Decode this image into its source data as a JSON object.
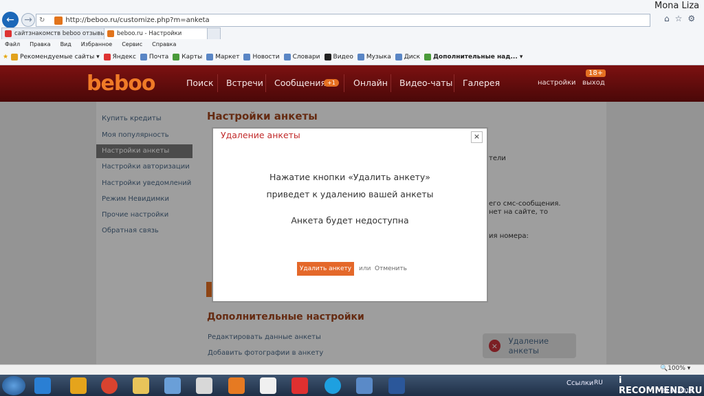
{
  "browser": {
    "url": "http://beboo.ru/customize.php?m=anketa",
    "title_user": "Mona Liza",
    "tabs": [
      {
        "label": "сайтзнакомств beboo отзывы — Ян..."
      },
      {
        "label": "beboo.ru - Настройки"
      }
    ],
    "menu": [
      "Файл",
      "Правка",
      "Вид",
      "Избранное",
      "Сервис",
      "Справка"
    ],
    "favorites": [
      "Рекомендуемые сайты ▾",
      "Яндекс",
      "Почта",
      "Карты",
      "Маркет",
      "Новости",
      "Словари",
      "Видео",
      "Музыка",
      "Диск",
      "Дополнительные над... ▾"
    ]
  },
  "site": {
    "logo": "beboo",
    "nav": [
      "Поиск",
      "Встречи",
      "Сообщения",
      "Онлайн",
      "Видео-чаты",
      "Галерея"
    ],
    "messages_badge": "+1",
    "age_badge": "18+",
    "settings_link": "настройки",
    "exit_link": "выход"
  },
  "sidebar": {
    "items": [
      {
        "label": "Купить кредиты"
      },
      {
        "label": "Моя популярность"
      },
      {
        "label": "Настройки анкеты"
      },
      {
        "label": "Настройки авторизации"
      },
      {
        "label": "Настройки уведомлений"
      },
      {
        "label": "Режим Невидимки"
      },
      {
        "label": "Прочие настройки"
      },
      {
        "label": "Обратная связь"
      }
    ]
  },
  "main": {
    "heading": "Настройки анкеты",
    "partial_texts": [
      "тели",
      "его смс-сообщения.",
      "нет на сайте, то",
      "ия номера:"
    ],
    "additional_heading": "Дополнительные настройки",
    "links": [
      "Редактировать данные анкеты",
      "Добавить фотографии в анкету"
    ],
    "delete_profile_label": "Удаление анкеты"
  },
  "modal": {
    "title": "Удаление анкеты",
    "line1": "Нажатие кнопки «Удалить анкету»",
    "line2": "приведет к удалению вашей анкеты",
    "line3": "Анкета будет недоступна",
    "confirm_label": "Удалить анкету",
    "or_label": "или",
    "cancel_label": "Отменить"
  },
  "statusbar": {
    "zoom": "🔍100% ▾"
  },
  "taskbar": {
    "links_label": "Ссылки",
    "lang": "RU",
    "watermark": "i RECOMMEND.RU",
    "date": "24.04.2013"
  },
  "colors": {
    "accent": "#e57022",
    "header": "#5e0c0c",
    "link": "#4d6b8a",
    "heading": "#a3461d"
  }
}
